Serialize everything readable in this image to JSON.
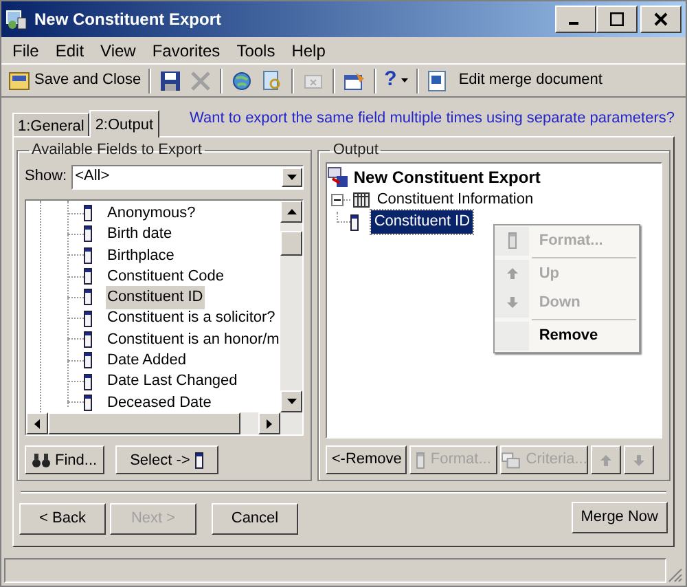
{
  "window": {
    "title": "New Constituent Export"
  },
  "menu": [
    "File",
    "Edit",
    "View",
    "Favorites",
    "Tools",
    "Help"
  ],
  "toolbar": {
    "save_and_close": "Save and Close",
    "help": "?",
    "edit_merge": "Edit merge document"
  },
  "tabs": [
    {
      "label": "1:General",
      "selected": false
    },
    {
      "label": "2:Output",
      "selected": true
    }
  ],
  "hint_link": "Want to export the same field multiple times using separate parameters?",
  "available": {
    "title": "Available Fields to Export",
    "show_label": "Show:",
    "show_value": "<All>",
    "fields": [
      {
        "label": "Anonymous?",
        "selected": false
      },
      {
        "label": "Birth date",
        "selected": false
      },
      {
        "label": "Birthplace",
        "selected": false
      },
      {
        "label": "Constituent Code",
        "selected": false
      },
      {
        "label": "Constituent ID",
        "selected": true
      },
      {
        "label": "Constituent is a solicitor?",
        "selected": false
      },
      {
        "label": "Constituent is an honor/m",
        "selected": false
      },
      {
        "label": "Date Added",
        "selected": false
      },
      {
        "label": "Date Last Changed",
        "selected": false
      },
      {
        "label": "Deceased Date",
        "selected": false
      }
    ],
    "find": "Find...",
    "select": "Select ->"
  },
  "output": {
    "title": "Output",
    "root": "New Constituent Export",
    "group": {
      "label": "Constituent Information",
      "expanded": true,
      "children": [
        {
          "label": "Constituent ID",
          "selected": true
        }
      ]
    },
    "buttons": [
      {
        "kind": "text",
        "label": "<-Remove",
        "disabled": false
      },
      {
        "kind": "field",
        "label": "Format...",
        "disabled": true
      },
      {
        "kind": "criteria",
        "label": "Criteria...",
        "disabled": true
      },
      {
        "kind": "up",
        "disabled": true
      },
      {
        "kind": "down",
        "disabled": true
      }
    ]
  },
  "context_menu": [
    {
      "kind": "field",
      "label": "Format...",
      "disabled": true
    },
    {
      "kind": "separator"
    },
    {
      "kind": "up",
      "label": "Up",
      "disabled": true
    },
    {
      "kind": "down",
      "label": "Down",
      "disabled": true
    },
    {
      "kind": "separator"
    },
    {
      "kind": "plain",
      "label": "Remove",
      "disabled": false
    }
  ],
  "footer": [
    {
      "label": "< Back",
      "disabled": false
    },
    {
      "label": "Next >",
      "disabled": true
    },
    {
      "label": "Cancel",
      "disabled": false
    }
  ],
  "merge_now": "Merge Now"
}
